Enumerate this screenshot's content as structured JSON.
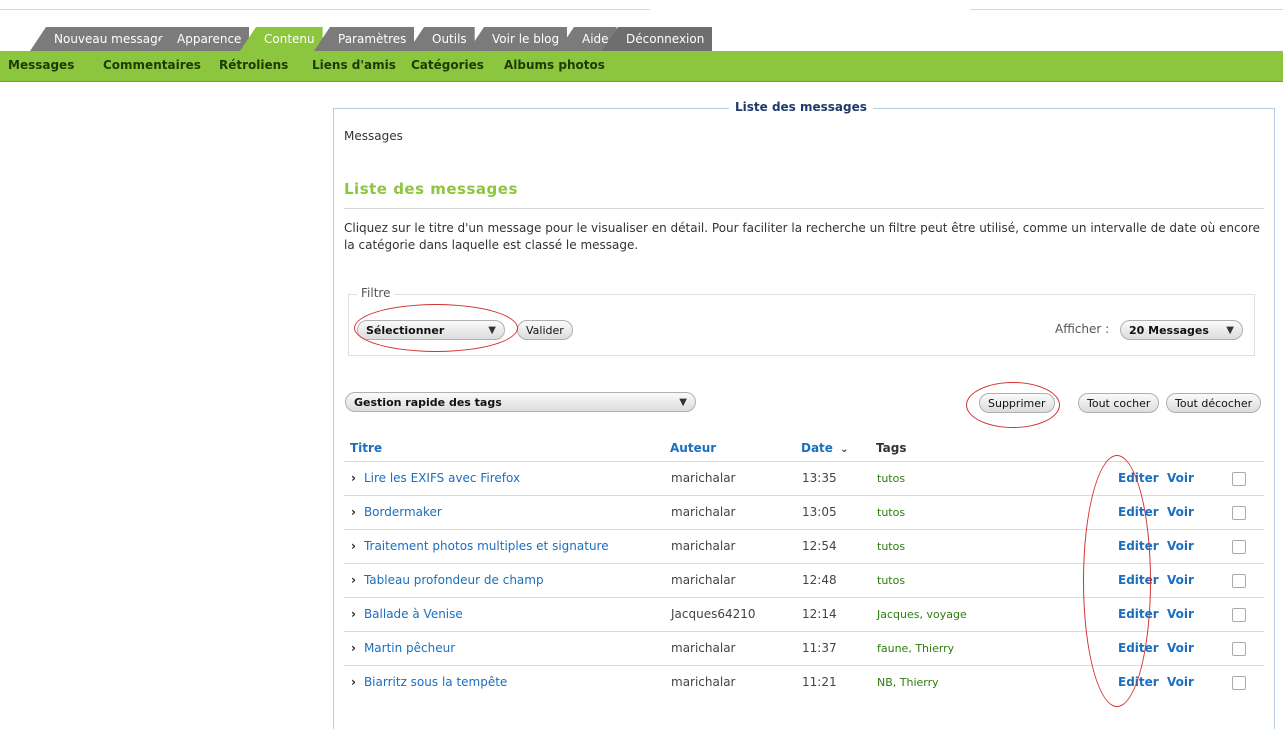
{
  "nav": {
    "tabs": [
      {
        "label": "Nouveau message"
      },
      {
        "label": "Apparence"
      },
      {
        "label": "Contenu"
      },
      {
        "label": "Paramètres"
      },
      {
        "label": "Outils"
      },
      {
        "label": "Voir le blog"
      },
      {
        "label": "Aide"
      },
      {
        "label": "Déconnexion"
      }
    ],
    "active_tab": "Contenu",
    "subnav": [
      "Messages",
      "Commentaires",
      "Rétroliens",
      "Liens d'amis",
      "Catégories",
      "Albums photos"
    ]
  },
  "panel": {
    "legend": "Liste des messages",
    "breadcrumb": "Messages",
    "heading": "Liste des messages",
    "intro": "Cliquez sur le titre d'un message pour le visualiser en détail. Pour faciliter la recherche un filtre peut être utilisé, comme un intervalle de date où encore la catégorie dans laquelle est classé le message."
  },
  "filter": {
    "legend": "Filtre",
    "select_value": "Sélectionner",
    "validate": "Valider",
    "show_label": "Afficher :",
    "show_value": "20 Messages"
  },
  "actions": {
    "tags_select": "Gestion rapide des tags",
    "delete": "Supprimer",
    "check_all": "Tout cocher",
    "uncheck_all": "Tout décocher"
  },
  "table": {
    "headers": {
      "title": "Titre",
      "author": "Auteur",
      "date": "Date",
      "tags": "Tags"
    },
    "edit_label": "Editer",
    "view_label": "Voir",
    "rows": [
      {
        "title": "Lire les EXIFS avec Firefox",
        "author": "marichalar",
        "time": "13:35",
        "tags": "tutos"
      },
      {
        "title": "Bordermaker",
        "author": "marichalar",
        "time": "13:05",
        "tags": "tutos"
      },
      {
        "title": "Traitement photos multiples et signature",
        "author": "marichalar",
        "time": "12:54",
        "tags": "tutos"
      },
      {
        "title": "Tableau profondeur de champ",
        "author": "marichalar",
        "time": "12:48",
        "tags": "tutos"
      },
      {
        "title": "Ballade à Venise",
        "author": "Jacques64210",
        "time": "12:14",
        "tags": "Jacques, voyage"
      },
      {
        "title": "Martin pêcheur",
        "author": "marichalar",
        "time": "11:37",
        "tags": "faune, Thierry"
      },
      {
        "title": "Biarritz sous la tempête",
        "author": "marichalar",
        "time": "11:21",
        "tags": "NB, Thierry"
      }
    ]
  },
  "colors": {
    "accent": "#8cc63e",
    "link": "#1a6fc0",
    "annotation": "#d23232"
  }
}
